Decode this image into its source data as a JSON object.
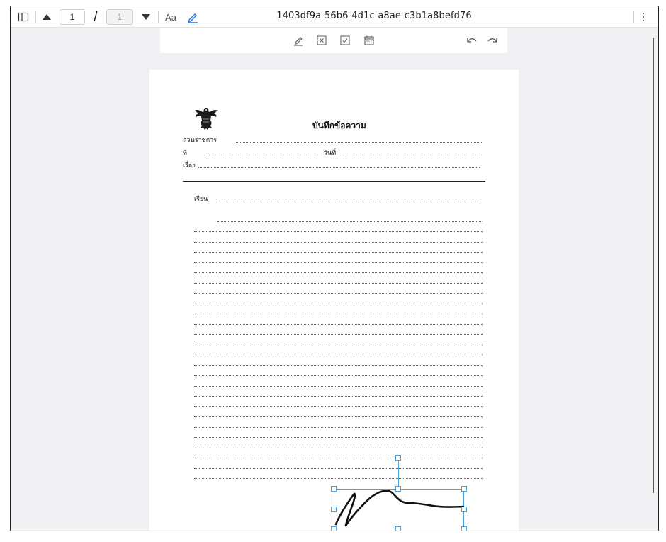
{
  "viewer": {
    "document_title": "1403df9a-56b6-4d1c-a8ae-c3b1a8befd76",
    "current_page": "1",
    "page_separator": "/",
    "total_pages": "1",
    "text_tool_label": "Aa"
  },
  "icons": {
    "sidebar": "sidebar-toggle-icon",
    "prev": "triangle-up-icon",
    "next": "triangle-down-icon",
    "draw": "pen-icon",
    "more": "vertical-dots-icon",
    "annot_draw": "pencil-icon",
    "annot_cross": "x-box-icon",
    "annot_check": "check-box-icon",
    "annot_date": "calendar-icon",
    "undo": "undo-icon",
    "redo": "redo-icon"
  },
  "colors": {
    "accent": "#1a73e8",
    "selection": "#4aa3df"
  },
  "memo": {
    "title": "บันทึกข้อความ",
    "department_label": "ส่วนราชการ",
    "ref_label": "ที่",
    "date_label": "วันที่",
    "subject_label": "เรื่อง",
    "to_label": "เรียน"
  }
}
